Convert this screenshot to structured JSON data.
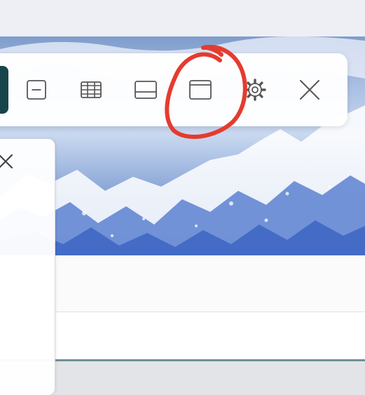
{
  "toolbar": {
    "buttons": [
      {
        "name": "minimize-view",
        "icon": "minus-box-icon"
      },
      {
        "name": "table-view",
        "icon": "table-grid-icon"
      },
      {
        "name": "bottom-split-view",
        "icon": "bottom-panel-icon"
      },
      {
        "name": "window-view",
        "icon": "window-icon"
      },
      {
        "name": "settings",
        "icon": "gear-icon"
      },
      {
        "name": "close",
        "icon": "close-icon"
      }
    ]
  },
  "panel": {
    "close_icon": "close-icon"
  },
  "colors": {
    "active_chip": "#17454a",
    "icon": "#555555",
    "annotation": "#e53b2f",
    "accent_line": "#6f8f9a"
  }
}
